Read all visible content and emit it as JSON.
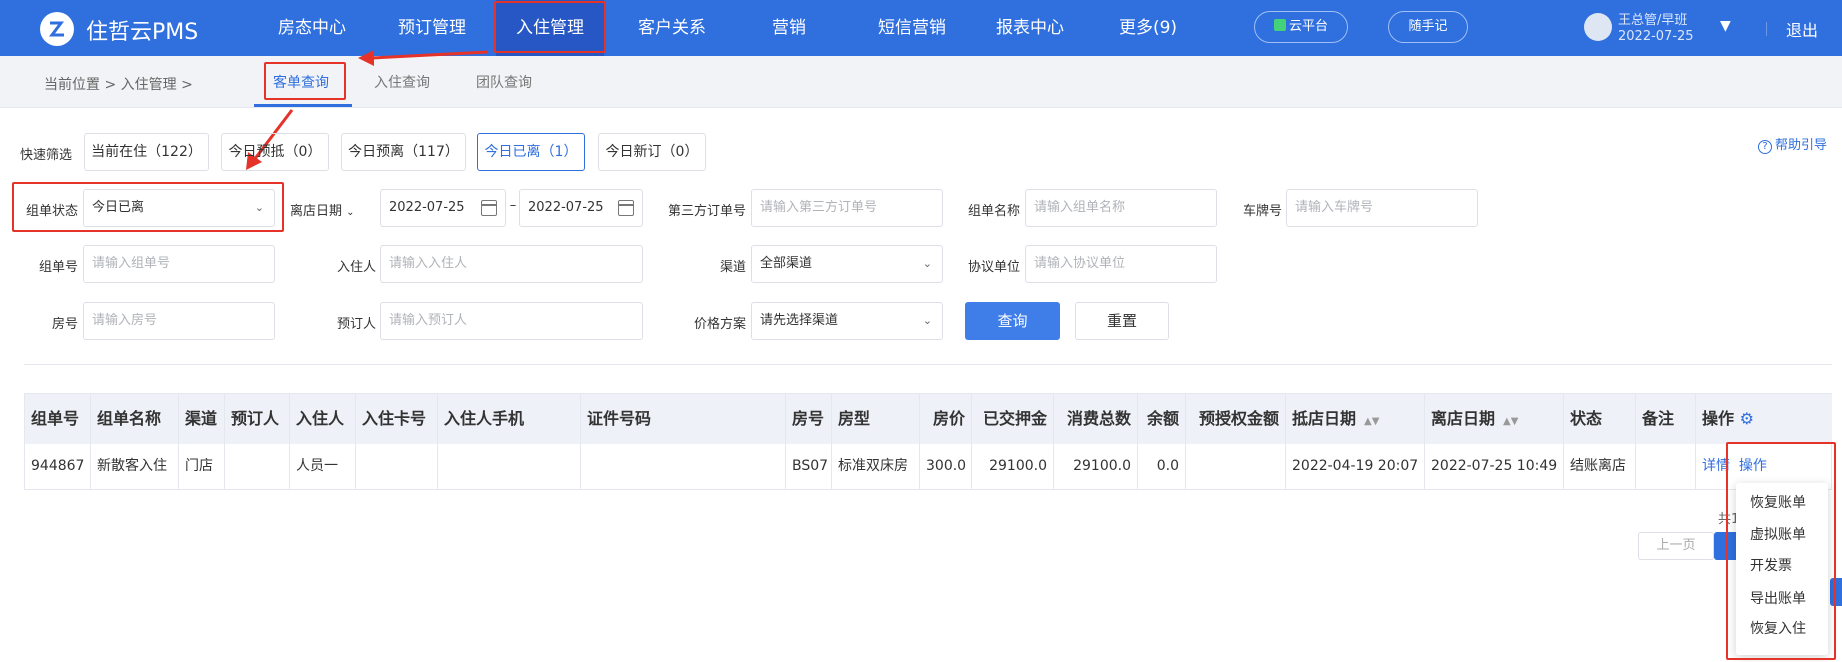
{
  "nav": {
    "brand": "住哲云PMS",
    "items": [
      "房态中心",
      "预订管理",
      "入住管理",
      "客户关系",
      "营销",
      "短信营销",
      "报表中心",
      "更多(9)"
    ],
    "cloud": "云平台",
    "notes": "随手记",
    "user": "王总管/早班",
    "date": "2022-07-25",
    "logout": "退出"
  },
  "breadcrumb": "当前位置 > 入住管理 >",
  "subtabs": [
    "客单查询",
    "入住查询",
    "团队查询"
  ],
  "help": "帮助引导",
  "quick": {
    "label": "快速筛选",
    "buttons": [
      "当前在住（122）",
      "今日预抵（0）",
      "今日预离（117）",
      "今日已离（1）",
      "今日新订（0）"
    ]
  },
  "filters": {
    "status_label": "组单状态",
    "status_value": "今日已离",
    "date_label": "离店日期",
    "date_from": "2022-07-25",
    "date_to": "2022-07-25",
    "date_sep": "–",
    "third_label": "第三方订单号",
    "third_ph": "请输入第三方订单号",
    "group_name_label": "组单名称",
    "group_name_ph": "请输入组单名称",
    "plate_label": "车牌号",
    "plate_ph": "请输入车牌号",
    "group_no_label": "组单号",
    "group_no_ph": "请输入组单号",
    "guest_label": "入住人",
    "guest_ph": "请输入入住人",
    "channel_label": "渠道",
    "channel_value": "全部渠道",
    "agreement_label": "协议单位",
    "agreement_ph": "请输入协议单位",
    "room_label": "房号",
    "room_ph": "请输入房号",
    "booker_label": "预订人",
    "booker_ph": "请输入预订人",
    "price_label": "价格方案",
    "price_value": "请先选择渠道",
    "search": "查询",
    "reset": "重置"
  },
  "table": {
    "headers": [
      "组单号",
      "组单名称",
      "渠道",
      "预订人",
      "入住人",
      "入住卡号",
      "入住人手机",
      "证件号码",
      "房号",
      "房型",
      "房价",
      "已交押金",
      "消费总数",
      "余额",
      "预授权金额",
      "抵店日期",
      "离店日期",
      "状态",
      "备注",
      "操作"
    ],
    "row": [
      "944867",
      "新散客入住",
      "门店",
      "",
      "人员一",
      "",
      "",
      "",
      "BS07",
      "标准双床房",
      "300.0",
      "29100.0",
      "29100.0",
      "0.0",
      "",
      "2022-04-19 20:07",
      "2022-07-25 10:49",
      "结账离店",
      "",
      ""
    ],
    "detail": "详情",
    "op": "操作"
  },
  "menu": [
    "恢复账单",
    "虚拟账单",
    "开发票",
    "导出账单",
    "恢复入住"
  ],
  "pager": {
    "prev": "上一页",
    "total_frag": "共1"
  }
}
